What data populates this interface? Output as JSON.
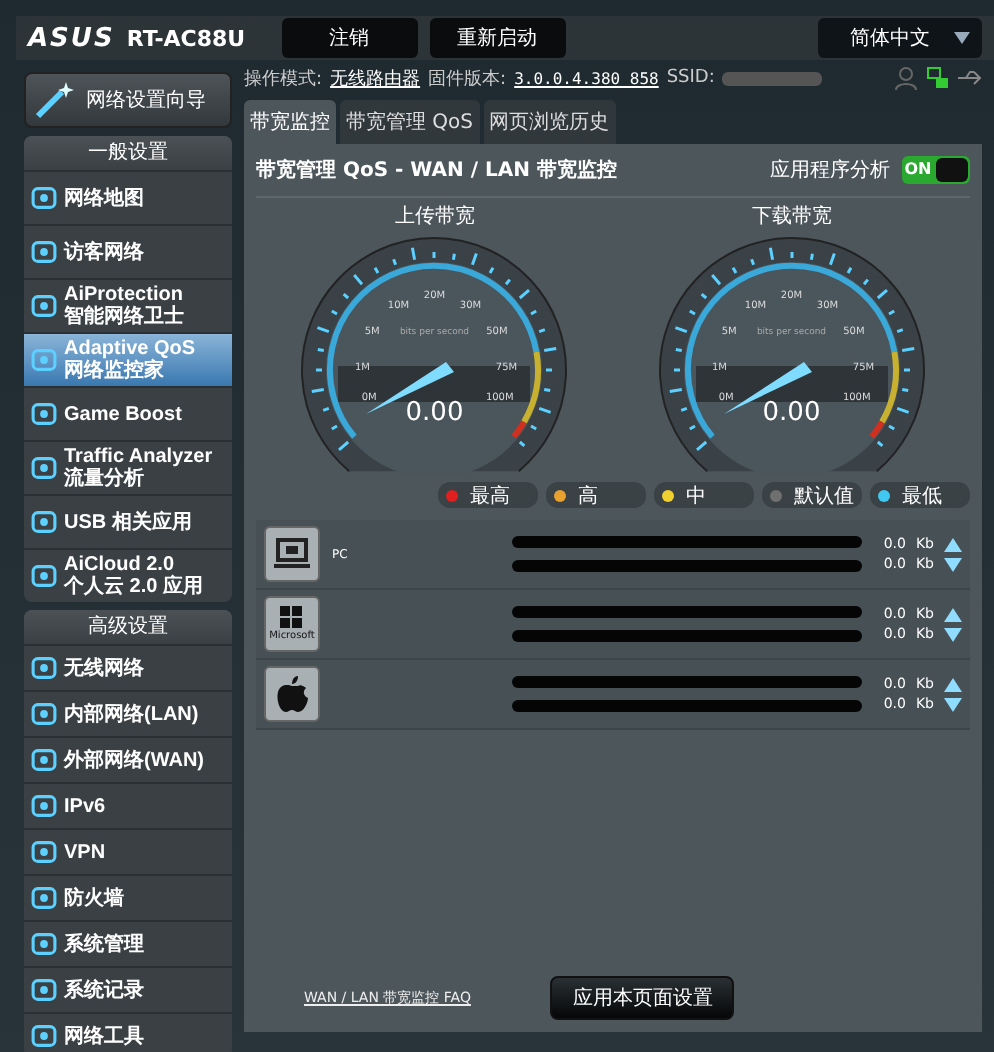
{
  "header": {
    "logo": "ASUS",
    "model": "RT-AC88U",
    "buttons": [
      "注销",
      "重新启动"
    ],
    "language": "简体中文"
  },
  "status_line": {
    "mode_label": "操作模式:",
    "mode": "无线路由器",
    "firmware_label": "固件版本:",
    "firmware": "3.0.0.4.380_858",
    "ssid_label": "SSID:"
  },
  "sidebar": {
    "wizard": "网络设置向导",
    "sections": [
      {
        "title": "一般设置",
        "items": [
          {
            "label": "网络地图",
            "selected": false
          },
          {
            "label": "访客网络",
            "selected": false
          },
          {
            "label": "AiProtection",
            "sub": "智能网络卫士",
            "selected": false
          },
          {
            "label": "Adaptive QoS",
            "sub": "网络监控家",
            "selected": true
          },
          {
            "label": "Game Boost",
            "selected": false
          },
          {
            "label": "Traffic Analyzer",
            "sub": "流量分析",
            "selected": false
          },
          {
            "label": "USB 相关应用",
            "selected": false
          },
          {
            "label": "AiCloud 2.0",
            "sub": "个人云 2.0 应用",
            "selected": false
          }
        ]
      },
      {
        "title": "高级设置",
        "items": [
          {
            "label": "无线网络",
            "selected": false
          },
          {
            "label": "内部网络(LAN)",
            "selected": false
          },
          {
            "label": "外部网络(WAN)",
            "selected": false
          },
          {
            "label": "IPv6",
            "selected": false
          },
          {
            "label": "VPN",
            "selected": false
          },
          {
            "label": "防火墙",
            "selected": false
          },
          {
            "label": "系统管理",
            "selected": false
          },
          {
            "label": "系统记录",
            "selected": false
          },
          {
            "label": "网络工具",
            "selected": false
          }
        ]
      }
    ]
  },
  "tabs": [
    {
      "label": "带宽监控",
      "selected": true
    },
    {
      "label": "带宽管理 QoS",
      "selected": false
    },
    {
      "label": "网页浏览历史",
      "selected": false
    }
  ],
  "panel": {
    "title": "带宽管理 QoS - WAN / LAN 带宽监控",
    "toggle_label": "应用程序分析",
    "toggle": {
      "on": true,
      "text": "ON"
    }
  },
  "gauges": [
    {
      "title": "上传带宽",
      "value": "0.00",
      "unit": "bits per second",
      "ticks": [
        "0M",
        "1M",
        "5M",
        "10M",
        "20M",
        "30M",
        "50M",
        "75M",
        "100M"
      ]
    },
    {
      "title": "下载带宽",
      "value": "0.00",
      "unit": "bits per second",
      "ticks": [
        "0M",
        "1M",
        "5M",
        "10M",
        "20M",
        "30M",
        "50M",
        "75M",
        "100M"
      ]
    }
  ],
  "legend": [
    {
      "label": "最高",
      "color": "#e02020"
    },
    {
      "label": "高",
      "color": "#e8a030"
    },
    {
      "label": "中",
      "color": "#f0d030"
    },
    {
      "label": "默认值",
      "color": "#707070"
    },
    {
      "label": "最低",
      "color": "#40c8f0"
    }
  ],
  "devices": [
    {
      "kind": "pc",
      "name": "PC",
      "up": "0.0",
      "up_unit": "Kb",
      "down": "0.0",
      "down_unit": "Kb"
    },
    {
      "kind": "windows",
      "badge": "Microsoft",
      "up": "0.0",
      "up_unit": "Kb",
      "down": "0.0",
      "down_unit": "Kb"
    },
    {
      "kind": "apple",
      "up": "0.0",
      "up_unit": "Kb",
      "down": "0.0",
      "down_unit": "Kb"
    }
  ],
  "footer": {
    "faq": "WAN / LAN 带宽监控 FAQ",
    "apply": "应用本页面设置"
  }
}
